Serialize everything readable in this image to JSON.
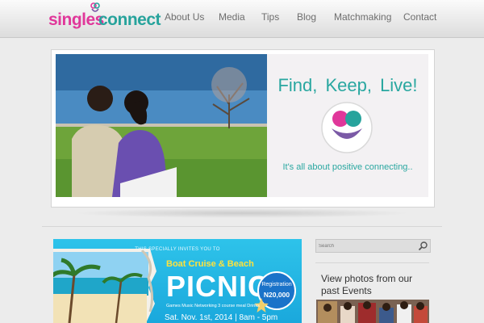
{
  "site": {
    "logo_part1": "singles",
    "logo_part2": "connect"
  },
  "nav": {
    "items": [
      {
        "label": "About Us"
      },
      {
        "label": "Media"
      },
      {
        "label": "Tips"
      },
      {
        "label": "Blog"
      },
      {
        "label": "Matchmaking"
      },
      {
        "label": "Contact"
      }
    ]
  },
  "banner": {
    "tagline": "Find, Keep, Live!",
    "subline": "It's all about positive connecting.."
  },
  "flyer": {
    "invite_text": "THIS SPECIALLY INVITES YOU TO",
    "title_line1": "Boat Cruise & Beach",
    "title_line2": "PICNIC",
    "registration_label": "Registration",
    "registration_price": "N20,000",
    "activities": "Games  Music  Networking  3 course meal  Drinks",
    "date": "Sat. Nov. 1st, 2014 | 8am - 5pm"
  },
  "sidebar": {
    "search_placeholder": "Search",
    "photos_heading": "View photos from our past Events"
  },
  "colors": {
    "pink": "#e0379a",
    "teal": "#27a39c",
    "flyer_blue": "#1fb3e3"
  }
}
